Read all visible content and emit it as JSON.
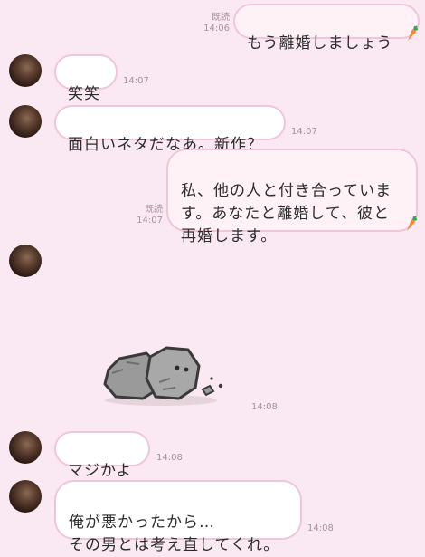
{
  "messages": [
    {
      "side": "me",
      "text": "もう離婚しましょう",
      "read": "既読",
      "time": "14:06"
    },
    {
      "side": "them",
      "text": "笑笑",
      "time": "14:07"
    },
    {
      "side": "them",
      "text": "面白いネタだなあ。新作？",
      "time": "14:07"
    },
    {
      "side": "me",
      "text": "私、他の人と付き合っていま\nす。あなたと離婚して、彼と\n再婚します。",
      "read": "既読",
      "time": "14:07"
    },
    {
      "side": "them",
      "sticker": "rock-creature-sticker",
      "time": "14:08"
    },
    {
      "side": "them",
      "text": "マジかよ",
      "time": "14:08"
    },
    {
      "side": "them",
      "text": "俺が悪かったから…\nその男とは考え直してくれ。",
      "time": "14:08"
    }
  ],
  "colors": {
    "background": "#fae9f2",
    "bubble_border": "#efc6d8",
    "meta_text": "#a88f9c"
  }
}
